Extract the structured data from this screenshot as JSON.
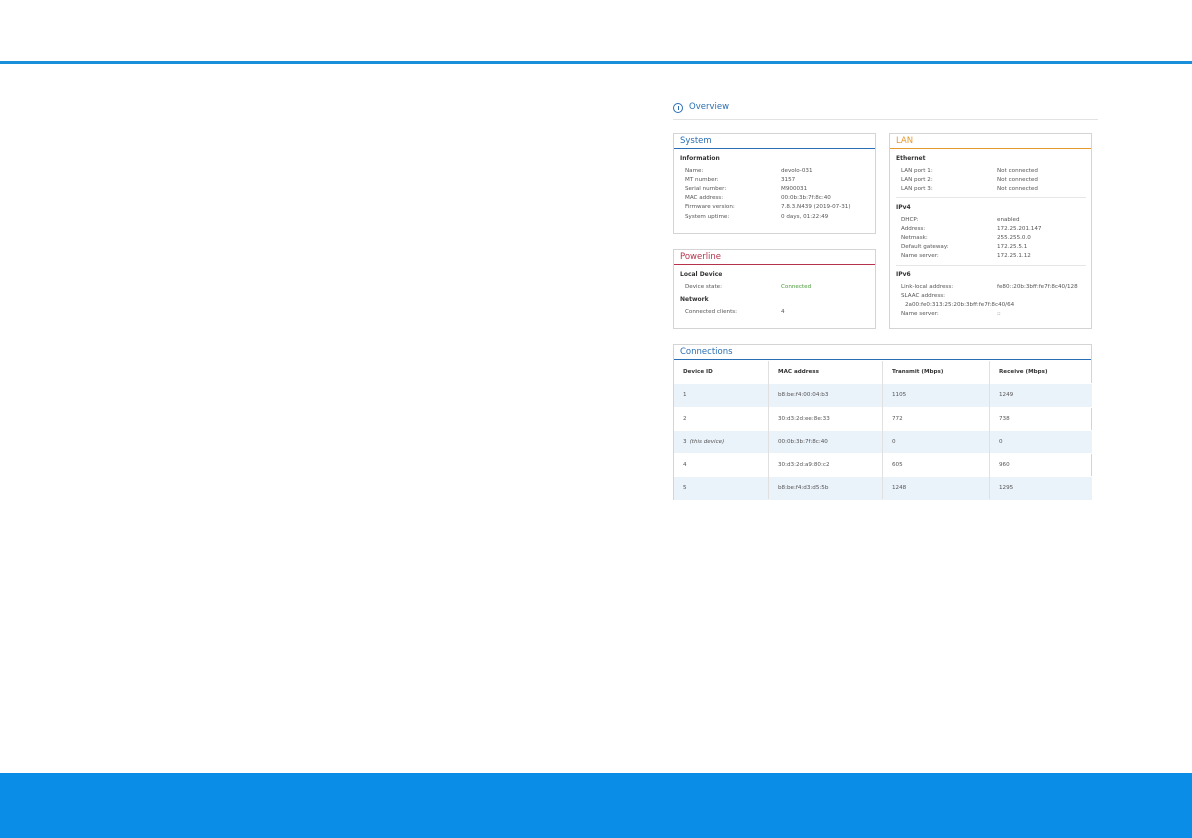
{
  "overview": {
    "title": "Overview"
  },
  "system": {
    "title": "System",
    "section": "Information",
    "rows": [
      {
        "k": "Name:",
        "v": "devolo-031"
      },
      {
        "k": "MT number:",
        "v": "3157"
      },
      {
        "k": "Serial number:",
        "v": "M900031"
      },
      {
        "k": "MAC address:",
        "v": "00:0b:3b:7f:8c:40"
      },
      {
        "k": "Firmware version:",
        "v": "7.8.3.N439 (2019-07-31)"
      },
      {
        "k": "System uptime:",
        "v": "0 days, 01:22:49"
      }
    ]
  },
  "powerline": {
    "title": "Powerline",
    "local_section": "Local Device",
    "device_state_k": "Device state:",
    "device_state_v": "Connected",
    "network_section": "Network",
    "clients_k": "Connected clients:",
    "clients_v": "4"
  },
  "lan": {
    "title": "LAN",
    "ethernet_section": "Ethernet",
    "ethernet": [
      {
        "k": "LAN port 1:",
        "v": "Not connected"
      },
      {
        "k": "LAN port 2:",
        "v": "Not connected"
      },
      {
        "k": "LAN port 3:",
        "v": "Not connected"
      }
    ],
    "ipv4_section": "IPv4",
    "ipv4": [
      {
        "k": "DHCP:",
        "v": "enabled"
      },
      {
        "k": "Address:",
        "v": "172.25.201.147"
      },
      {
        "k": "Netmask:",
        "v": "255.255.0.0"
      },
      {
        "k": "Default gateway:",
        "v": "172.25.5.1"
      },
      {
        "k": "Name server:",
        "v": "172.25.1.12"
      }
    ],
    "ipv6_section": "IPv6",
    "link_local_k": "Link-local address:",
    "link_local_v": "fe80::20b:3bff:fe7f:8c40/128",
    "slaac_k": "SLAAC address:",
    "slaac_v": "2a00:fe0:313:25:20b:3bff:fe7f:8c40/64",
    "name_server_k": "Name server:",
    "name_server_v": "::"
  },
  "connections": {
    "title": "Connections",
    "headers": [
      "Device ID",
      "MAC address",
      "Transmit (Mbps)",
      "Receive (Mbps)"
    ],
    "rows": [
      {
        "id": "1",
        "note": "",
        "mac": "b8:be:f4:00:04:b3",
        "tx": "1105",
        "rx": "1249"
      },
      {
        "id": "2",
        "note": "",
        "mac": "30:d3:2d:ee:8e:33",
        "tx": "772",
        "rx": "738"
      },
      {
        "id": "3",
        "note": "(this device)",
        "mac": "00:0b:3b:7f:8c:40",
        "tx": "0",
        "rx": "0"
      },
      {
        "id": "4",
        "note": "",
        "mac": "30:d3:2d:a9:80:c2",
        "tx": "605",
        "rx": "960"
      },
      {
        "id": "5",
        "note": "",
        "mac": "b8:be:f4:d3:d5:5b",
        "tx": "1248",
        "rx": "1295"
      }
    ]
  }
}
